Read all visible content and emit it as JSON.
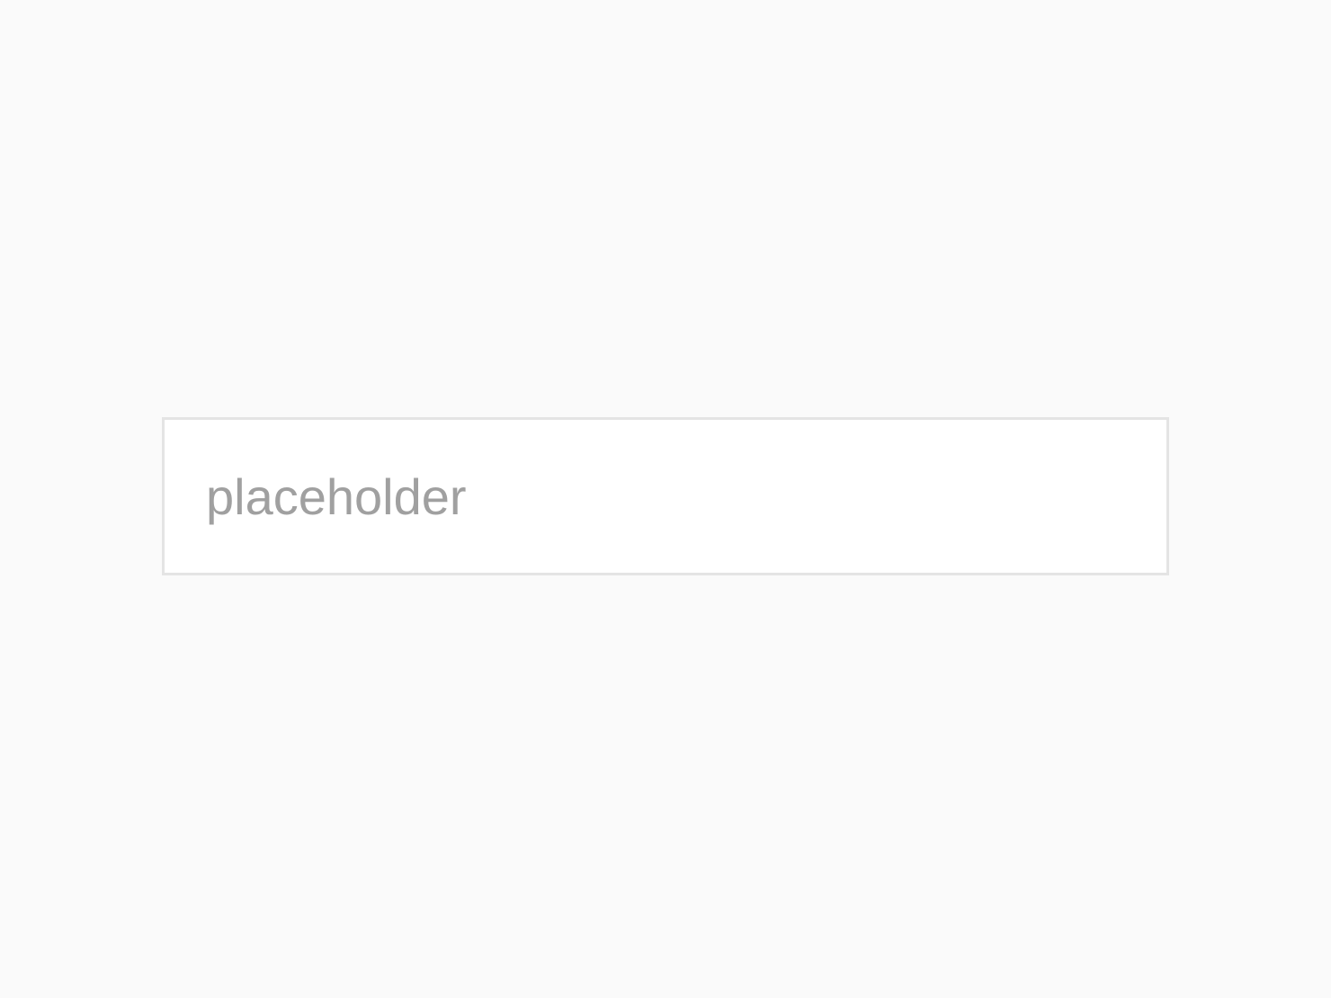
{
  "input": {
    "value": "",
    "placeholder": "placeholder"
  },
  "colors": {
    "page_background": "#fafafa",
    "input_background": "#ffffff",
    "input_border": "#e4e4e4",
    "placeholder_text": "#a0a0a0"
  }
}
